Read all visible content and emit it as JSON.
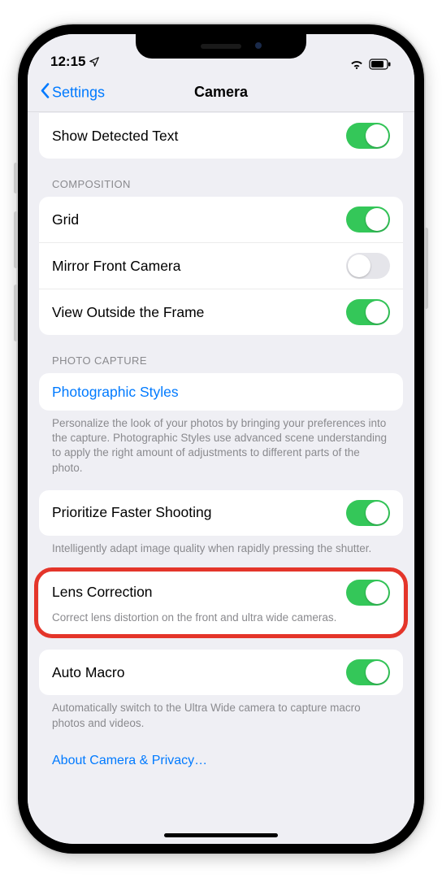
{
  "status": {
    "time": "12:15"
  },
  "nav": {
    "back": "Settings",
    "title": "Camera"
  },
  "section0": {
    "row_detected_text": {
      "label": "Show Detected Text",
      "on": true
    }
  },
  "section1": {
    "header": "COMPOSITION",
    "grid": {
      "label": "Grid",
      "on": true
    },
    "mirror": {
      "label": "Mirror Front Camera",
      "on": false
    },
    "frame": {
      "label": "View Outside the Frame",
      "on": true
    }
  },
  "section2": {
    "header": "PHOTO CAPTURE",
    "styles_link": "Photographic Styles",
    "styles_footer": "Personalize the look of your photos by bringing your preferences into the capture. Photographic Styles use advanced scene understanding to apply the right amount of adjustments to different parts of the photo."
  },
  "section3": {
    "prioritize": {
      "label": "Prioritize Faster Shooting",
      "on": true
    },
    "prioritize_footer": "Intelligently adapt image quality when rapidly pressing the shutter."
  },
  "section4": {
    "lens": {
      "label": "Lens Correction",
      "on": true
    },
    "lens_footer": "Correct lens distortion on the front and ultra wide cameras."
  },
  "section5": {
    "macro": {
      "label": "Auto Macro",
      "on": true
    },
    "macro_footer": "Automatically switch to the Ultra Wide camera to capture macro photos and videos."
  },
  "privacy_link": "About Camera & Privacy…"
}
